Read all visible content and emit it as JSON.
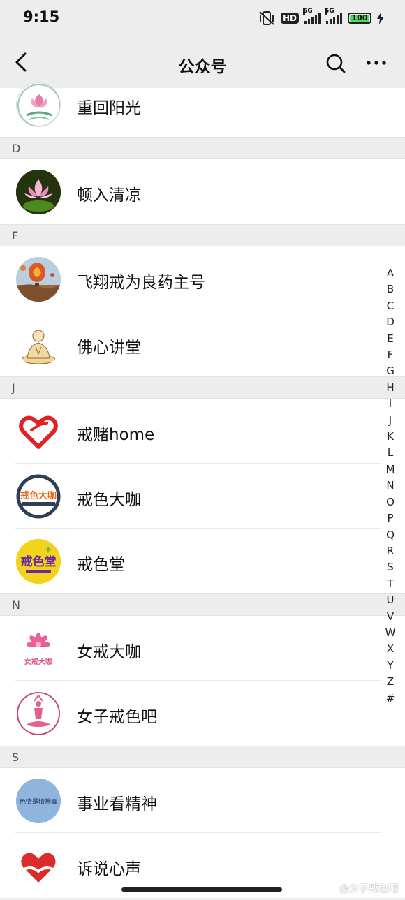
{
  "status": {
    "time": "9:15",
    "hd": "HD",
    "net1": "5G",
    "net2": "5G",
    "battery": "100"
  },
  "header": {
    "title": "公众号",
    "back_icon": "chevron-left-icon",
    "search_icon": "search-icon",
    "more_icon": "more-icon"
  },
  "sections": [
    {
      "letter": "D"
    },
    {
      "letter": "F"
    },
    {
      "letter": "J"
    },
    {
      "letter": "N"
    },
    {
      "letter": "S"
    }
  ],
  "accounts": [
    {
      "name": "重回阳光",
      "avatar_icon": "lotus-logo-icon"
    },
    {
      "name": "顿入清凉",
      "avatar_icon": "lotus-flower-icon"
    },
    {
      "name": "飞翔戒为良药主号",
      "avatar_icon": "hot-air-balloon-icon"
    },
    {
      "name": "佛心讲堂",
      "avatar_icon": "buddha-icon"
    },
    {
      "name": "戒赌home",
      "avatar_icon": "heart-hand-icon"
    },
    {
      "name": "戒色大咖",
      "avatar_icon": "circle-logo-icon",
      "avatar_text": "戒色大咖"
    },
    {
      "name": "戒色堂",
      "avatar_icon": "yellow-logo-icon",
      "avatar_text": "戒色堂"
    },
    {
      "name": "女戒大咖",
      "avatar_icon": "pink-flower-icon",
      "avatar_text": "女戒大咖"
    },
    {
      "name": "女子戒色吧",
      "avatar_icon": "yoga-figure-icon"
    },
    {
      "name": "事业看精神",
      "avatar_icon": "blue-circle-icon",
      "avatar_text": "色情是精神毒"
    },
    {
      "name": "诉说心声",
      "avatar_icon": "heart-hands-icon"
    }
  ],
  "index_letters": [
    "A",
    "B",
    "C",
    "D",
    "E",
    "F",
    "G",
    "H",
    "I",
    "J",
    "K",
    "L",
    "M",
    "N",
    "O",
    "P",
    "Q",
    "R",
    "S",
    "T",
    "U",
    "V",
    "W",
    "X",
    "Y",
    "Z",
    "#"
  ],
  "watermark": "@女子戒色吧",
  "colors": {
    "background": "#ededed",
    "row": "#ffffff",
    "battery": "#4cd964"
  }
}
